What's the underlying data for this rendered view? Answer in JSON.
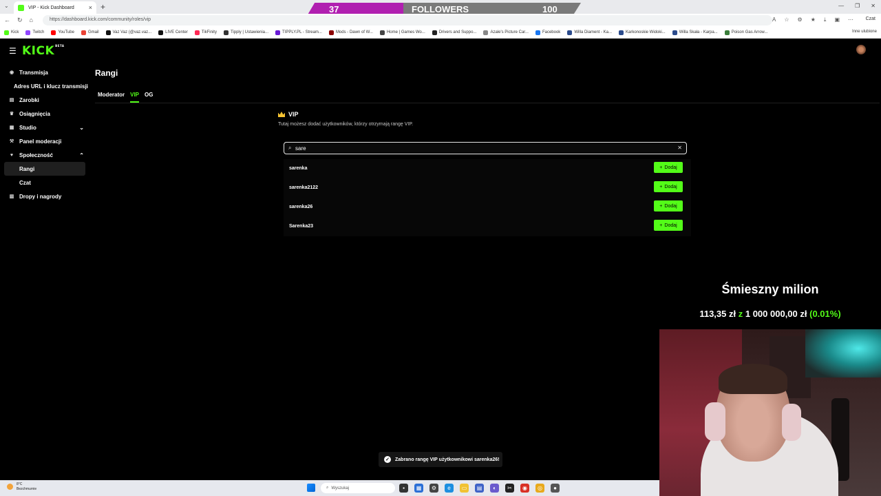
{
  "browser": {
    "tab_title": "VIP - Kick Dashboard",
    "url": "https://dashboard.kick.com/community/roles/vip",
    "bookmarks": [
      "Kick",
      "Twitch",
      "YouTube",
      "Gmail",
      "Vaz Vaz (@vaz.vaz...",
      "LIVE Center",
      "TikFinity",
      "Tipply | Ustawienia...",
      "TIPPLY.PL - Stream...",
      "Mods - Dawn of W...",
      "Home | Games Wo...",
      "Drivers and Suppo...",
      "Azale's Picture Car...",
      "Facebook",
      "Willa Diament - Ka...",
      "Karkonoskie Widoki...",
      "Willa Skała - Karpa...",
      "Poison Gas Arrow..."
    ],
    "bookmarks_other": "Inne ulubione",
    "copilot_label": "Czat"
  },
  "followers_bar": {
    "current": "37",
    "label": "FOLLOWERS",
    "goal": "100"
  },
  "sidebar": {
    "items": [
      {
        "label": "Transmisja",
        "icon": "broadcast-icon"
      },
      {
        "label": "Adres URL i klucz transmisji",
        "icon": ""
      },
      {
        "label": "Zarobki",
        "icon": "earnings-icon"
      },
      {
        "label": "Osiągnięcia",
        "icon": "trophy-icon"
      },
      {
        "label": "Studio",
        "icon": "studio-icon"
      },
      {
        "label": "Panel moderacji",
        "icon": "moderation-icon"
      },
      {
        "label": "Społeczność",
        "icon": "community-icon"
      },
      {
        "label": "Rangi",
        "icon": ""
      },
      {
        "label": "Czat",
        "icon": ""
      },
      {
        "label": "Dropy i nagrody",
        "icon": "drops-icon"
      }
    ]
  },
  "main": {
    "title": "Rangi",
    "tabs": [
      "Moderator",
      "VIP",
      "OG"
    ],
    "active_tab": "VIP",
    "vip_title": "VIP",
    "vip_description": "Tutaj możesz dodać użytkowników, którzy otrzymają rangę VIP.",
    "search_value": "sare",
    "results": [
      {
        "username": "sarenka",
        "button": "Dodaj"
      },
      {
        "username": "sarenka2122",
        "button": "Dodaj"
      },
      {
        "username": "sarenka26",
        "button": "Dodaj"
      },
      {
        "username": "Sarenka23",
        "button": "Dodaj"
      }
    ]
  },
  "toast": {
    "message": "Zabrano rangę VIP użytkownikowi sarenka26!"
  },
  "overlay": {
    "goal_title": "Śmieszny milion",
    "amount_current": "113,35 zł",
    "amount_sep": "z",
    "amount_goal": "1 000 000,00 zł",
    "amount_percent": "(0.01%)"
  },
  "taskbar": {
    "weather_temp": "8°C",
    "weather_desc": "Bezchmurnie",
    "search_placeholder": "Wyszukaj"
  },
  "colors": {
    "kick_green": "#53fc18",
    "followers_purple": "#b01fb0",
    "crown_gold": "#f6c331"
  }
}
